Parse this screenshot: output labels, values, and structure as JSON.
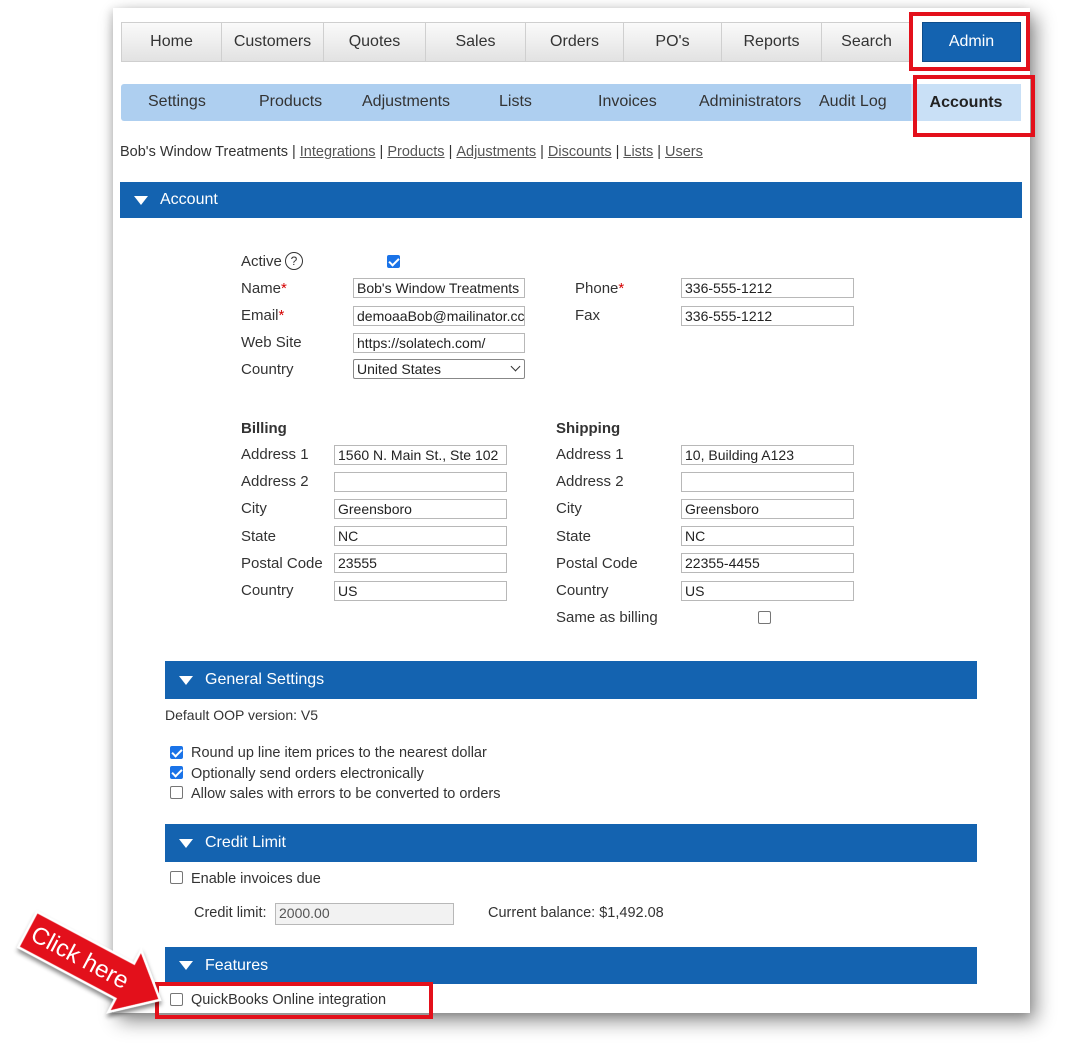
{
  "nav": {
    "tabs": [
      "Home",
      "Customers",
      "Quotes",
      "Sales",
      "Orders",
      "PO's",
      "Reports",
      "Search"
    ],
    "admin": "Admin"
  },
  "subnav": {
    "items": [
      "Settings",
      "Products",
      "Adjustments",
      "Lists",
      "Invoices",
      "Administrators",
      "Audit Log"
    ],
    "active": "Accounts"
  },
  "breadcrumb": {
    "account": "Bob's Window Treatments",
    "links": [
      "Integrations",
      "Products",
      "Adjustments",
      "Discounts",
      "Lists",
      "Users"
    ]
  },
  "account": {
    "header": "Account",
    "active_label": "Active",
    "active_checked": true,
    "help": "?",
    "name_label": "Name",
    "name": "Bob's Window Treatments",
    "email_label": "Email",
    "email": "demoaaBob@mailinator.cc",
    "website_label": "Web Site",
    "website": "https://solatech.com/",
    "country_label": "Country",
    "country": "United States",
    "phone_label": "Phone",
    "phone": "336-555-1212",
    "fax_label": "Fax",
    "fax": "336-555-1212",
    "required_mark": "*"
  },
  "billing": {
    "title": "Billing",
    "address1_label": "Address 1",
    "address1": "1560 N. Main St., Ste 102",
    "address2_label": "Address 2",
    "address2": "",
    "city_label": "City",
    "city": "Greensboro",
    "state_label": "State",
    "state": "NC",
    "postal_label": "Postal Code",
    "postal": "23555",
    "country_label": "Country",
    "country": "US"
  },
  "shipping": {
    "title": "Shipping",
    "address1_label": "Address 1",
    "address1": "10, Building A123",
    "address2_label": "Address 2",
    "address2": "",
    "city_label": "City",
    "city": "Greensboro",
    "state_label": "State",
    "state": "NC",
    "postal_label": "Postal Code",
    "postal": "22355-4455",
    "country_label": "Country",
    "country": "US",
    "same_label": "Same as billing",
    "same_checked": false
  },
  "general": {
    "header": "General Settings",
    "oop": "Default OOP version: V5",
    "options": [
      {
        "label": "Round up line item prices to the nearest dollar",
        "checked": true
      },
      {
        "label": "Optionally send orders electronically",
        "checked": true
      },
      {
        "label": "Allow sales with errors to be converted to orders",
        "checked": false
      }
    ]
  },
  "credit": {
    "header": "Credit Limit",
    "enable_label": "Enable invoices due",
    "enable_checked": false,
    "limit_label": "Credit limit:",
    "limit": "2000.00",
    "balance": "Current balance: $1,492.08"
  },
  "features": {
    "header": "Features",
    "qbo_label": "QuickBooks Online integration",
    "qbo_checked": false
  },
  "callout": {
    "text": "Click here",
    "color": "#e3101b"
  }
}
